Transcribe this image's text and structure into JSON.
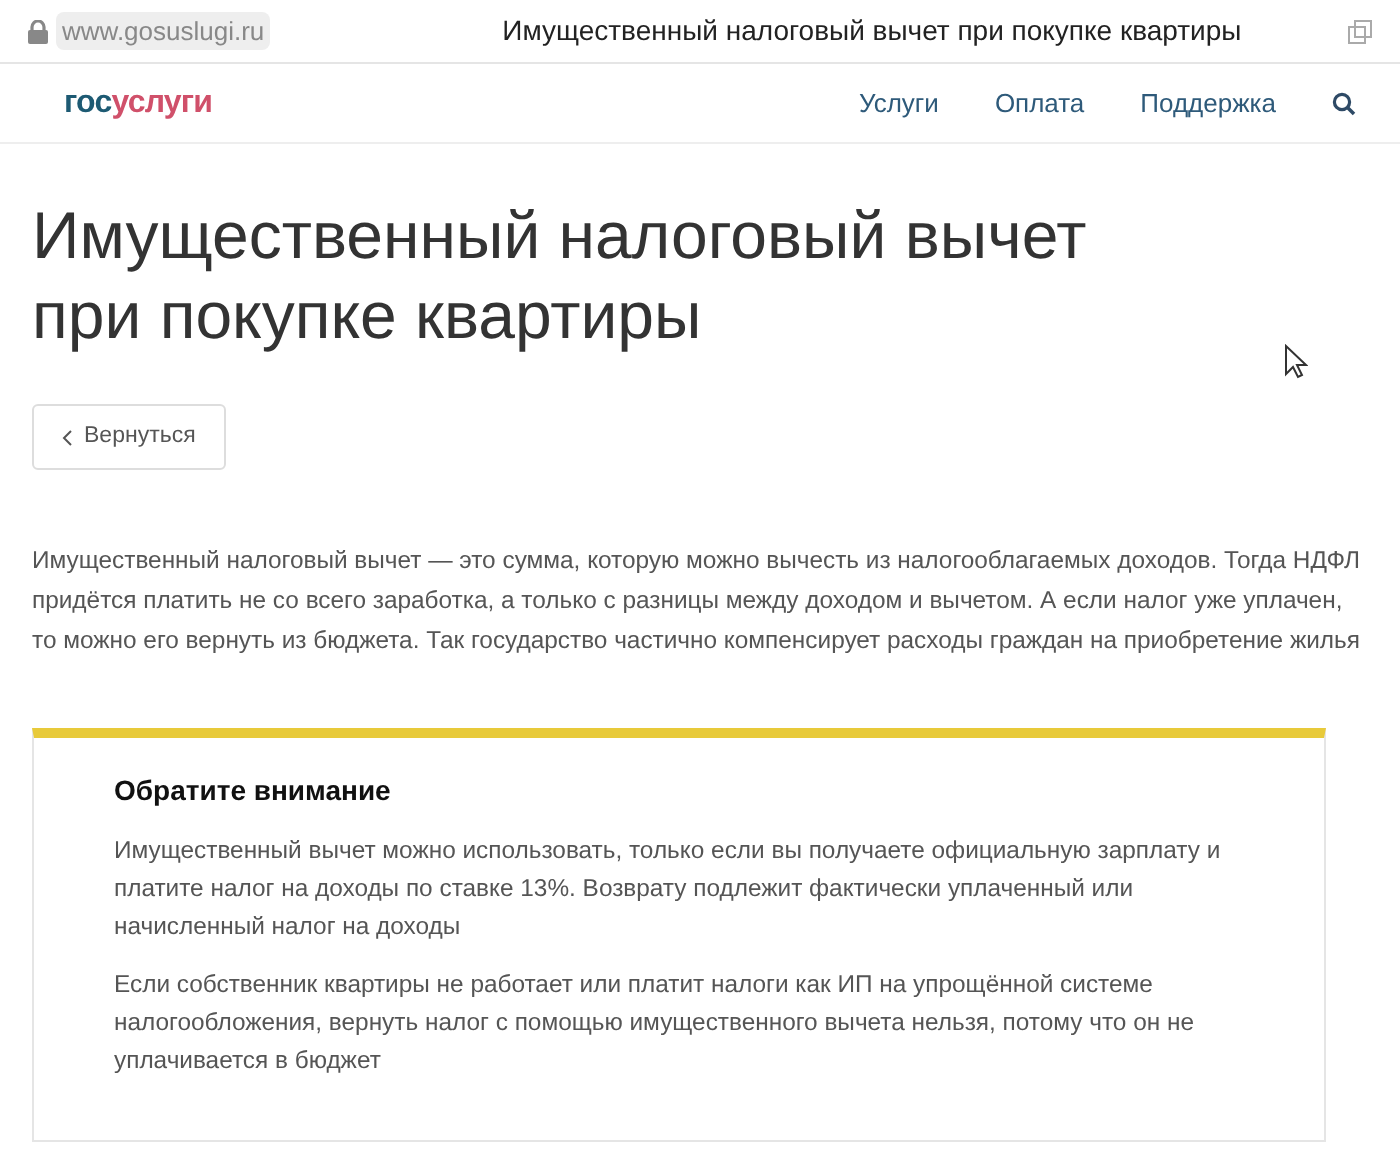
{
  "browser": {
    "url": "www.gosuslugi.ru",
    "tab_title": "Имущественный налоговый вычет при покупке квартиры"
  },
  "header": {
    "logo": [
      "гос",
      "услуги"
    ],
    "nav": [
      "Услуги",
      "Оплата",
      "Поддержка"
    ]
  },
  "title": "Имущественный налоговый вычет при покупке квартиры",
  "back_button": "Вернуться",
  "intro": "Имущественный налоговый вычет — это сумма, которую можно вычесть из налогооблагаемых доходов. Тогда НДФЛ придётся платить не со всего заработка, а только с разницы между доходом и вычетом. А если налог уже уплачен, то можно его вернуть из бюджета. Так государство частично компенсирует расходы граждан на приобретение жилья",
  "notice": {
    "title": "Обратите внимание",
    "paragraphs": [
      "Имущественный вычет можно использовать, только если вы получаете официальную зарплату и платите налог на доходы по ставке 13%. Возврату подлежит фактически уплаченный или начисленный налог на доходы",
      "Если собственник квартиры не работает или платит налоги как ИП на упрощённой системе налогообложения, вернуть налог с помощью имущественного вычета нельзя, потому что он не уплачивается в бюджет"
    ]
  }
}
